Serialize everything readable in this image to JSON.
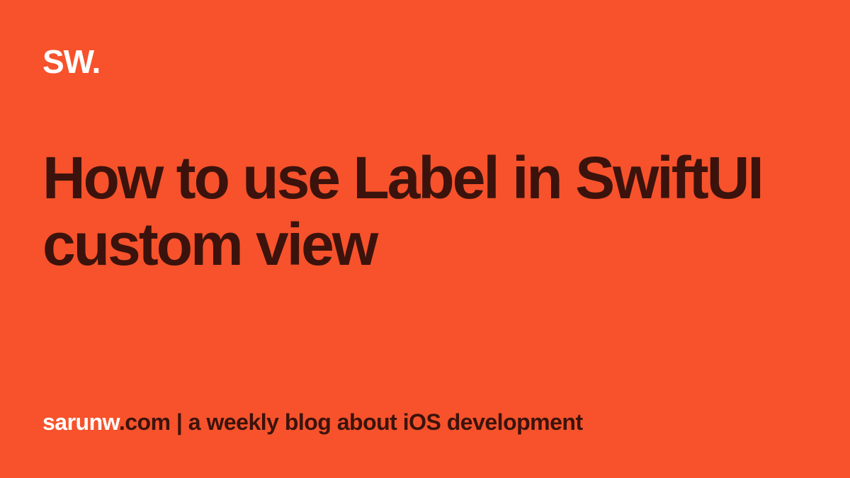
{
  "logo": "SW.",
  "title": "How to use Label in SwiftUI custom view",
  "footer": {
    "sitename": "sarunw",
    "tld": ".com",
    "separator": " | ",
    "description": "a weekly blog about iOS development"
  },
  "colors": {
    "background": "#F7522B",
    "logo": "#FFFFFF",
    "title": "#3B130C",
    "footer_sitename": "#FFFFFF",
    "footer_rest": "#3B130C"
  }
}
